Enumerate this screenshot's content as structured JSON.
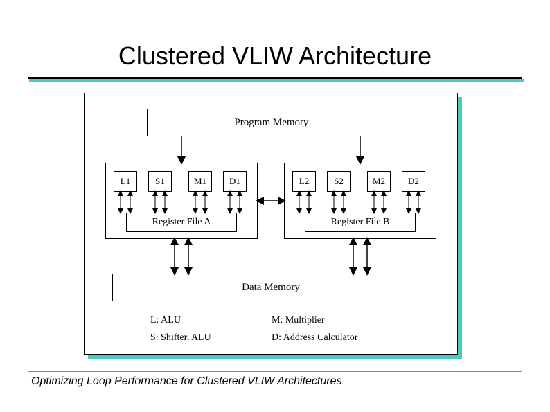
{
  "title": "Clustered VLIW Architecture",
  "footer": "Optimizing Loop Performance for Clustered VLIW Architectures",
  "program_memory": "Program Memory",
  "data_memory": "Data Memory",
  "cluster_a": {
    "units": [
      "L1",
      "S1",
      "M1",
      "D1"
    ],
    "regfile": "Register File A"
  },
  "cluster_b": {
    "units": [
      "L2",
      "S2",
      "M2",
      "D2"
    ],
    "regfile": "Register File B"
  },
  "legend": {
    "L": "L: ALU",
    "M": "M: Multiplier",
    "S": "S: Shifter, ALU",
    "D": "D: Address Calculator"
  }
}
